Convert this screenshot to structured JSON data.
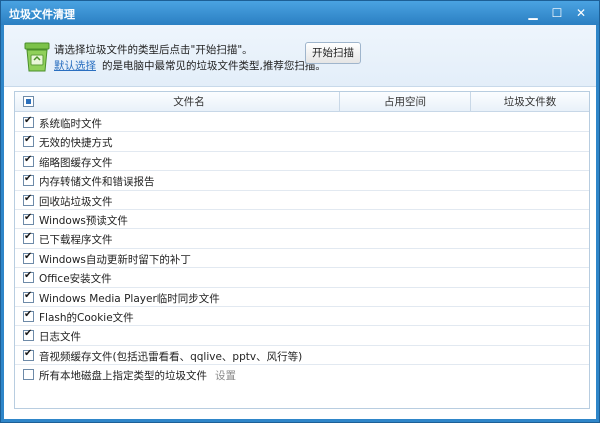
{
  "window": {
    "title": "垃圾文件清理"
  },
  "intro": {
    "instruction": "请选择垃圾文件的类型后点击\"开始扫描\"。",
    "default_link": "默认选择",
    "default_desc": "的是电脑中最常见的垃圾文件类型,推荐您扫描。",
    "scan_button": "开始扫描"
  },
  "table": {
    "columns": [
      "文件名",
      "占用空间",
      "垃圾文件数"
    ],
    "rows": [
      {
        "label": "系统临时文件",
        "checked": true
      },
      {
        "label": "无效的快捷方式",
        "checked": true
      },
      {
        "label": "缩略图缓存文件",
        "checked": true
      },
      {
        "label": "内存转储文件和错误报告",
        "checked": true
      },
      {
        "label": "回收站垃圾文件",
        "checked": true
      },
      {
        "label": "Windows预读文件",
        "checked": true
      },
      {
        "label": "已下载程序文件",
        "checked": true
      },
      {
        "label": "Windows自动更新时留下的补丁",
        "checked": true
      },
      {
        "label": "Office安装文件",
        "checked": true
      },
      {
        "label": "Windows Media Player临时同步文件",
        "checked": true
      },
      {
        "label": "Flash的Cookie文件",
        "checked": true
      },
      {
        "label": "日志文件",
        "checked": true
      },
      {
        "label": "音视频缓存文件(包括迅雷看看、qqlive、pptv、风行等)",
        "checked": true
      },
      {
        "label": "所有本地磁盘上指定类型的垃圾文件",
        "checked": false,
        "setting": "设置"
      }
    ]
  },
  "colors": {
    "accent": "#2f86c9",
    "link": "#2a6fc0"
  }
}
